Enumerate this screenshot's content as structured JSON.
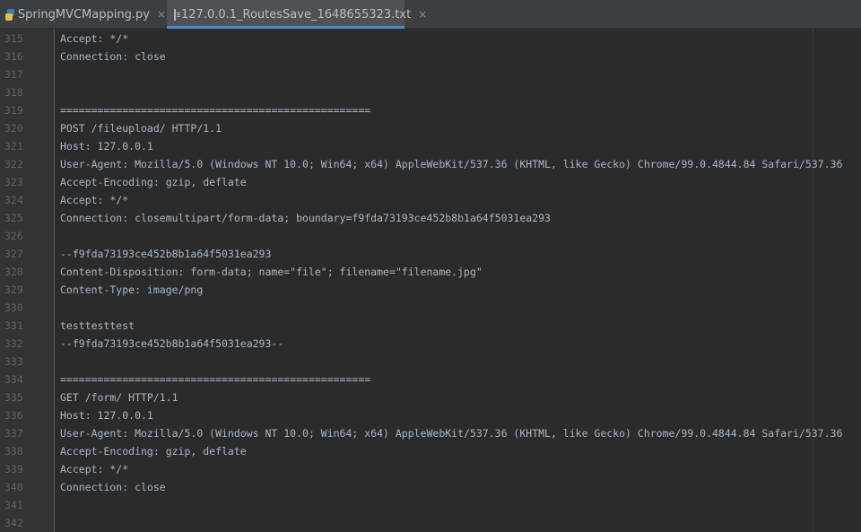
{
  "tabs": [
    {
      "label": "SpringMVCMapping.py",
      "close": "×",
      "icon": "python-file-icon"
    },
    {
      "label": "127.0.0.1_RoutesSave_1648655323.txt",
      "close": "×",
      "icon": "text-file-icon",
      "active": true
    }
  ],
  "editor": {
    "lines": [
      {
        "num": "315",
        "text": "Accept: */*"
      },
      {
        "num": "316",
        "text": "Connection: close"
      },
      {
        "num": "317",
        "text": ""
      },
      {
        "num": "318",
        "text": ""
      },
      {
        "num": "319",
        "text": "=================================================="
      },
      {
        "num": "320",
        "text": "POST /fileupload/ HTTP/1.1"
      },
      {
        "num": "321",
        "text": "Host: 127.0.0.1"
      },
      {
        "num": "322",
        "text": "User-Agent: Mozilla/5.0 (Windows NT 10.0; Win64; x64) AppleWebKit/537.36 (KHTML, like Gecko) Chrome/99.0.4844.84 Safari/537.36"
      },
      {
        "num": "323",
        "text": "Accept-Encoding: gzip, deflate"
      },
      {
        "num": "324",
        "text": "Accept: */*"
      },
      {
        "num": "325",
        "text": "Connection: closemultipart/form-data; boundary=f9fda73193ce452b8b1a64f5031ea293"
      },
      {
        "num": "326",
        "text": ""
      },
      {
        "num": "327",
        "text": "--f9fda73193ce452b8b1a64f5031ea293"
      },
      {
        "num": "328",
        "text": "Content-Disposition: form-data; name=\"file\"; filename=\"filename.jpg\""
      },
      {
        "num": "329",
        "text": "Content-Type: image/png"
      },
      {
        "num": "330",
        "text": ""
      },
      {
        "num": "331",
        "text": "testtesttest"
      },
      {
        "num": "332",
        "text": "--f9fda73193ce452b8b1a64f5031ea293--"
      },
      {
        "num": "333",
        "text": ""
      },
      {
        "num": "334",
        "text": "=================================================="
      },
      {
        "num": "335",
        "text": "GET /form/ HTTP/1.1"
      },
      {
        "num": "336",
        "text": "Host: 127.0.0.1"
      },
      {
        "num": "337",
        "text": "User-Agent: Mozilla/5.0 (Windows NT 10.0; Win64; x64) AppleWebKit/537.36 (KHTML, like Gecko) Chrome/99.0.4844.84 Safari/537.36"
      },
      {
        "num": "338",
        "text": "Accept-Encoding: gzip, deflate"
      },
      {
        "num": "339",
        "text": "Accept: */*"
      },
      {
        "num": "340",
        "text": "Connection: close"
      },
      {
        "num": "341",
        "text": ""
      },
      {
        "num": "342",
        "text": ""
      }
    ]
  },
  "colors": {
    "background": "#2b2b2b",
    "gutter": "#313335",
    "text": "#a9b7c6",
    "line_number": "#606366",
    "tab_active_underline": "#4a88c7"
  }
}
